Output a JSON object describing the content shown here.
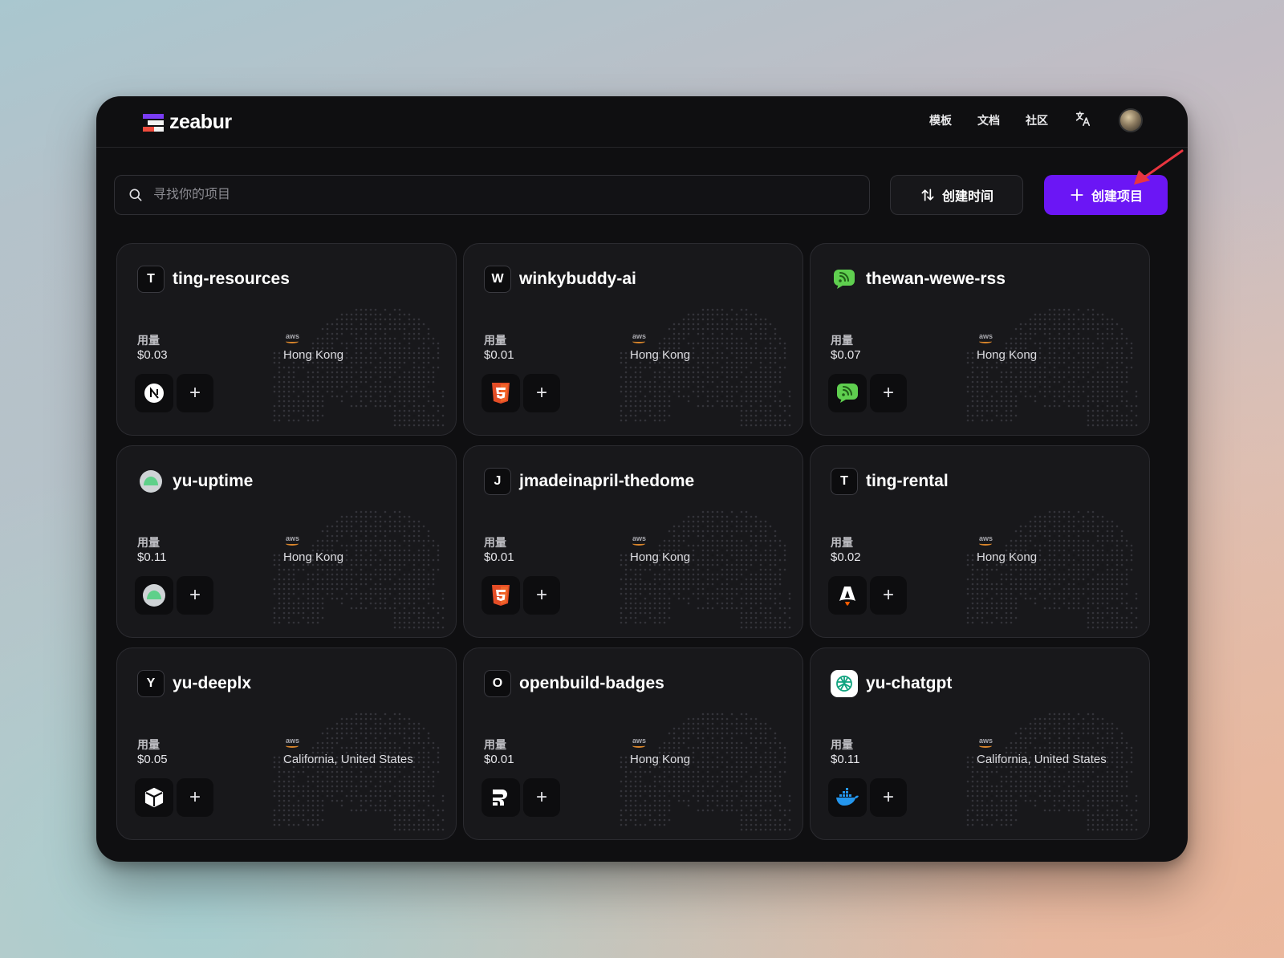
{
  "app": {
    "logo_text": "zeabur"
  },
  "nav": {
    "templates": "模板",
    "docs": "文档",
    "community": "社区",
    "translate_icon": "文A"
  },
  "search": {
    "placeholder": "寻找你的项目"
  },
  "toolbar": {
    "sort_label": "创建时间",
    "create_label": "创建项目"
  },
  "colors": {
    "accent": "#6b16f5",
    "annotation_arrow": "#e8353f"
  },
  "projects": [
    {
      "icon_letter": "T",
      "icon": "letter",
      "name": "ting-resources",
      "usage_label": "用量",
      "usage": "$0.03",
      "provider": "aws",
      "region": "Hong Kong",
      "service": "nextjs-icon"
    },
    {
      "icon_letter": "W",
      "icon": "letter",
      "name": "winkybuddy-ai",
      "usage_label": "用量",
      "usage": "$0.01",
      "provider": "aws",
      "region": "Hong Kong",
      "service": "html5-icon"
    },
    {
      "icon_letter": "",
      "icon": "rss-chat-icon",
      "name": "thewan-wewe-rss",
      "usage_label": "用量",
      "usage": "$0.07",
      "provider": "aws",
      "region": "Hong Kong",
      "service": "rss-chat-icon"
    },
    {
      "icon_letter": "",
      "icon": "uptime-kuma-icon",
      "name": "yu-uptime",
      "usage_label": "用量",
      "usage": "$0.11",
      "provider": "aws",
      "region": "Hong Kong",
      "service": "uptime-kuma-icon"
    },
    {
      "icon_letter": "J",
      "icon": "letter",
      "name": "jmadeinapril-thedome",
      "usage_label": "用量",
      "usage": "$0.01",
      "provider": "aws",
      "region": "Hong Kong",
      "service": "html5-icon"
    },
    {
      "icon_letter": "T",
      "icon": "letter",
      "name": "ting-rental",
      "usage_label": "用量",
      "usage": "$0.02",
      "provider": "aws",
      "region": "Hong Kong",
      "service": "astro-icon"
    },
    {
      "icon_letter": "Y",
      "icon": "letter",
      "name": "yu-deeplx",
      "usage_label": "用量",
      "usage": "$0.05",
      "provider": "aws",
      "region": "California, United States",
      "service": "cube-icon"
    },
    {
      "icon_letter": "O",
      "icon": "letter",
      "name": "openbuild-badges",
      "usage_label": "用量",
      "usage": "$0.01",
      "provider": "aws",
      "region": "Hong Kong",
      "service": "remix-icon"
    },
    {
      "icon_letter": "",
      "icon": "openai-icon",
      "name": "yu-chatgpt",
      "usage_label": "用量",
      "usage": "$0.11",
      "provider": "aws",
      "region": "California, United States",
      "service": "docker-icon"
    }
  ]
}
